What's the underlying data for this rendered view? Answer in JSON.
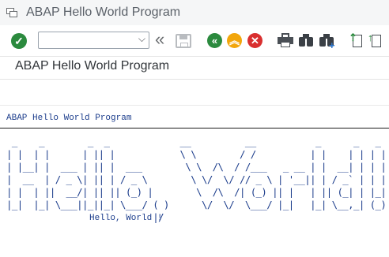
{
  "window": {
    "title": "ABAP Hello World Program"
  },
  "toolbar": {
    "command_field": {
      "value": "",
      "placeholder": ""
    },
    "buttons": [
      {
        "name": "enter",
        "icon": "check-icon",
        "color": "#2b8a3e"
      },
      {
        "name": "back",
        "icon": "double-left-arrow-icon",
        "color": "#2b8a3e"
      },
      {
        "name": "exit",
        "icon": "double-up-arrow-icon",
        "color": "#f2a60c"
      },
      {
        "name": "cancel",
        "icon": "close-icon",
        "color": "#d92f2f"
      }
    ]
  },
  "screen": {
    "title": "ABAP Hello World Program"
  },
  "list": {
    "header": "ABAP Hello World Program",
    "ascii_art": [
      " _    _        _  _             __          __           _      _   _ ",
      "| |  | |      | || |            \\ \\        / /          | |    | | | |",
      "| |__| |  ___ | || |  ___        \\ \\  /\\  / /___   _ __ | |  __| | | |",
      "|  __  | / _ \\| || | / _ \\        \\ \\/  \\/ // _ \\ | '__|| | / _` | | |",
      "| |  | ||  __/| || || (_) |        \\  /\\  /| (_) || |   | || (_| | |_|",
      "|_|  |_| \\___||_||_| \\___/ ( )      \\/  \\/  \\___/ |_|   |_| \\__,_| (_)",
      "                           |/                                          "
    ],
    "greeting": "Hello, World !"
  },
  "colors": {
    "list_text": "#1c3d8c",
    "title_bar_bg": "#f5f6f7"
  }
}
